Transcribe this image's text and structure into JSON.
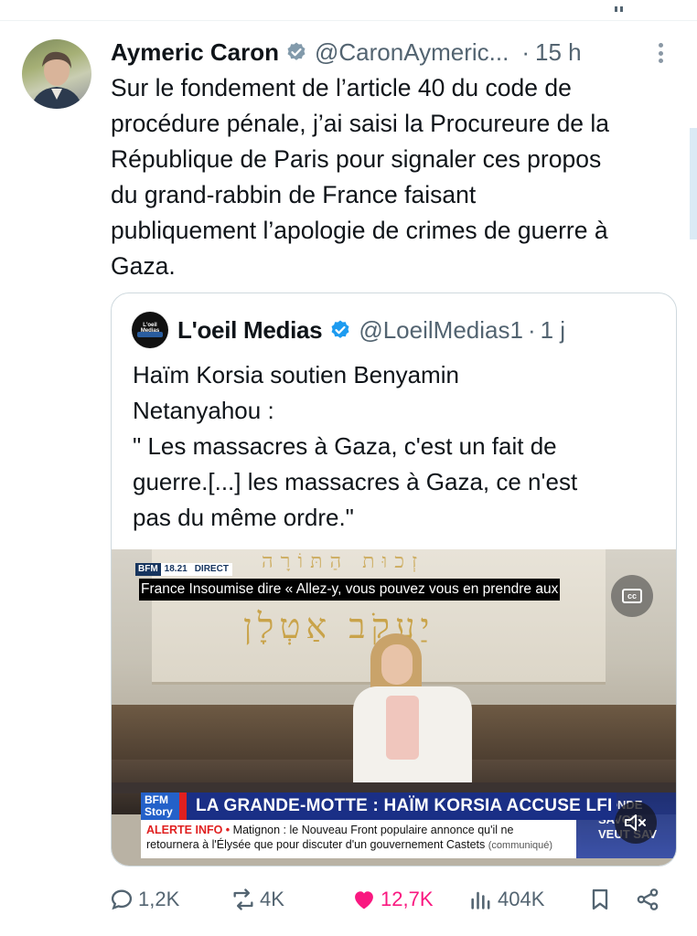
{
  "tweet": {
    "author_name": "Aymeric Caron",
    "handle": "@CaronAymeric...",
    "separator": "·",
    "time": "15 h",
    "text_lines": [
      "Sur le fondement de l’article 40 du code de",
      "procédure pénale, j’ai saisi la Procureure de la",
      "République de Paris pour signaler ces propos",
      "du grand-rabbin de France faisant",
      "publiquement l’apologie de crimes de guerre à",
      "Gaza."
    ]
  },
  "quote": {
    "author_name": "L'oeil Medias",
    "avatar_text": "L'oeil Medias",
    "handle": "@LoeilMedias1",
    "separator": "·",
    "time": "1 j",
    "text_lines": [
      "Haïm Korsia soutien Benyamin",
      "Netanyahou  :",
      "\" Les massacres à Gaza, c'est un fait de",
      "guerre.[...] les massacres à Gaza, ce n'est",
      "pas du même ordre.\""
    ]
  },
  "video": {
    "channel_logo": "BFM",
    "hour": "18.21",
    "live_label": "DIRECT",
    "subtitle": "France Insoumise dire « Allez-y, vous pouvez vous en prendre aux",
    "cc_label": "cc",
    "banner_logo": "BFM Story",
    "banner_text": "LA GRANDE-MOTTE : HAÏM KORSIA ACCUSE LFI",
    "ticker_alert": "ALERTE INFO •",
    "ticker_line1": " Matignon : le Nouveau Front populaire annonce qu'il ne",
    "ticker_line2": "retournera à l'Élysée que pour discuter d'un gouvernement Castets",
    "ticker_note": "(communiqué)",
    "side_logo": "MONDE SAVOIR VEUT SAV",
    "hebrew_main": "יַעֲקֹב אַטְלָן",
    "hebrew_top": "זְכוּת הַתּוֹרָה"
  },
  "actions": {
    "replies": "1,2K",
    "reposts": "4K",
    "likes": "12,7K",
    "views": "404K"
  },
  "colors": {
    "text": "#0f1419",
    "secondary": "#536471",
    "like": "#f91880",
    "verified": "#536471"
  }
}
